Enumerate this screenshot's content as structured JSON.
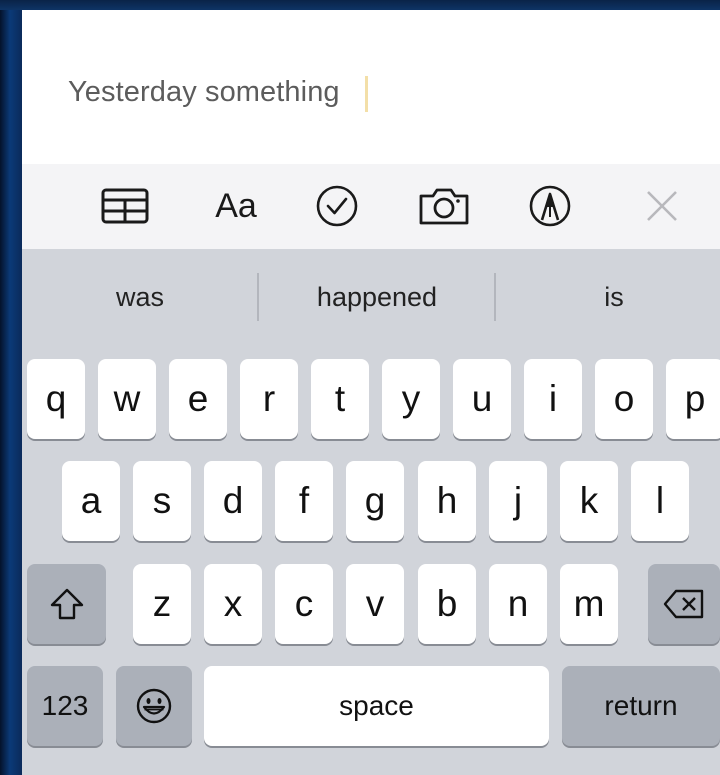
{
  "note": {
    "text": "Yesterday something"
  },
  "toolbar": {
    "items": [
      {
        "icon": "table-icon"
      },
      {
        "icon": "format-text-icon",
        "label": "Aa"
      },
      {
        "icon": "checklist-icon"
      },
      {
        "icon": "camera-icon"
      },
      {
        "icon": "markup-pen-icon"
      },
      {
        "icon": "close-icon"
      }
    ]
  },
  "keyboard": {
    "suggestions": [
      "was",
      "happened",
      "is"
    ],
    "row1": [
      "q",
      "w",
      "e",
      "r",
      "t",
      "y",
      "u",
      "i",
      "o",
      "p"
    ],
    "row2": [
      "a",
      "s",
      "d",
      "f",
      "g",
      "h",
      "j",
      "k",
      "l"
    ],
    "row3": [
      "z",
      "x",
      "c",
      "v",
      "b",
      "n",
      "m"
    ],
    "shift_icon": "shift-icon",
    "delete_icon": "backspace-icon",
    "numbers_label": "123",
    "emoji_icon": "emoji-icon",
    "space_label": "space",
    "return_label": "return"
  }
}
